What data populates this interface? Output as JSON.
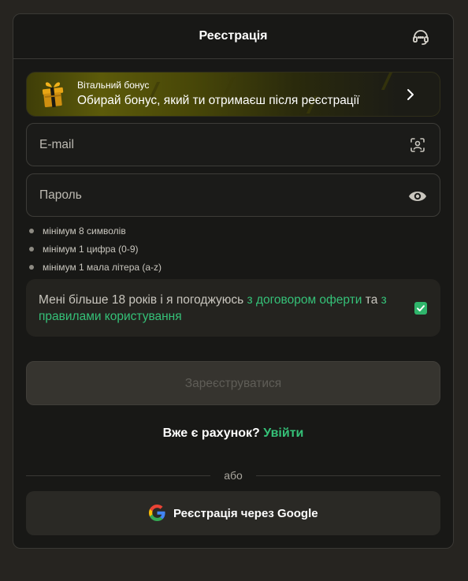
{
  "header": {
    "title": "Реєстрація",
    "support_icon": "headset-icon"
  },
  "bonus": {
    "subtitle": "Вітальний бонус",
    "text": "Обирай бонус, який ти отримаєш після реєстрації",
    "icon": "gift-icon",
    "chevron": "chevron-right-icon"
  },
  "email": {
    "placeholder": "E-mail",
    "icon": "contact-scan-icon"
  },
  "password": {
    "placeholder": "Пароль",
    "icon": "eye-icon"
  },
  "password_rules": [
    "мінімум 8 символів",
    "мінімум 1 цифра (0-9)",
    "мінімум 1 мала літера (a-z)"
  ],
  "agreement": {
    "text_before": "Мені більше 18 років і я погоджуюсь ",
    "offer_link": "з договором оферти",
    "text_middle": " та ",
    "rules_link": "з правилами користування",
    "checked": true
  },
  "submit_label": "Зареєструватися",
  "login": {
    "question": "Вже є рахунок? ",
    "link": "Увійти"
  },
  "divider_label": "або",
  "google_label": "Реєстрація через Google",
  "colors": {
    "accent": "#35c178",
    "checkbox": "#2fb56b",
    "background": "#181816"
  }
}
